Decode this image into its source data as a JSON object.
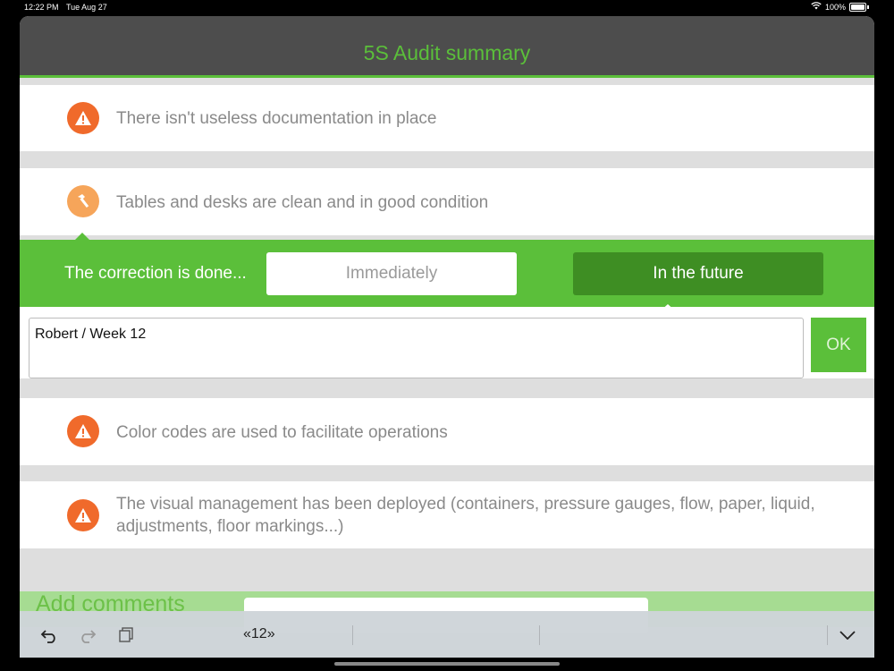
{
  "status_bar": {
    "time": "12:22 PM",
    "date": "Tue Aug 27",
    "battery": "100%"
  },
  "header": {
    "title": "5S Audit summary"
  },
  "items": [
    {
      "text": "There isn't useless documentation in place",
      "icon": "warning-icon"
    },
    {
      "text": "Tables and desks are clean and in good condition",
      "icon": "hammer-icon"
    },
    {
      "text": "Color codes are used to facilitate operations",
      "icon": "warning-icon"
    },
    {
      "text": "The visual management has been deployed (containers, pressure gauges, flow, paper, liquid, adjustments, floor markings...)",
      "icon": "warning-icon"
    }
  ],
  "correction": {
    "label": "The correction is done...",
    "options": [
      "Immediately",
      "In the future"
    ],
    "selected": "In the future"
  },
  "note_input": {
    "value": "Robert / Week 12",
    "ok_label": "OK"
  },
  "comments": {
    "label": "Add comments"
  },
  "toolbar": {
    "page_field": "«12»"
  },
  "colors": {
    "accent_green": "#5bbf3a",
    "dark_green": "#3e8e23",
    "warning_orange": "#f06a2b",
    "hammer_orange": "#f6a55a",
    "header_gray": "#4d4d4d"
  }
}
